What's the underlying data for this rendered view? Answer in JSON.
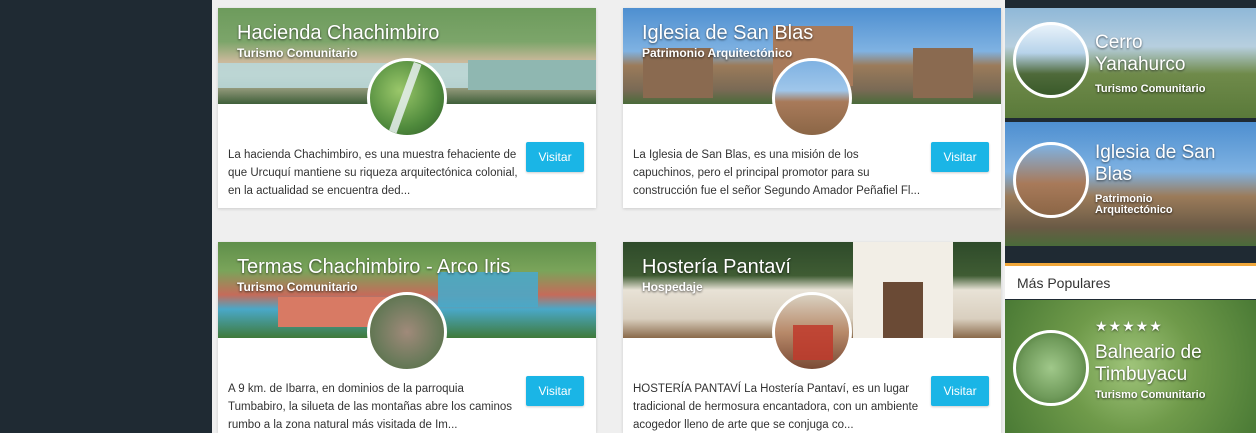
{
  "cards": [
    {
      "title": "Hacienda Chachimbiro",
      "subtitle": "Turismo Comunitario",
      "description": "La hacienda Chachimbiro, es una muestra fehaciente de que Urcuquí mantiene su riqueza arquitectónica colonial, en la actualidad se encuentra ded...",
      "button": "Visitar"
    },
    {
      "title": "Iglesia de San Blas",
      "subtitle": "Patrimonio Arquitectónico",
      "description": "La Iglesia de San Blas, es una misión de los capuchinos, pero el principal promotor para su construcción fue el señor Segundo Amador Peñafiel Fl...",
      "button": "Visitar"
    },
    {
      "title": "Termas Chachimbiro - Arco Iris",
      "subtitle": "Turismo Comunitario",
      "description": "A 9 km. de Ibarra, en dominios de la parroquia Tumbabiro, la silueta de las montañas abre los caminos rumbo a la zona natural más visitada de Im...",
      "button": "Visitar"
    },
    {
      "title": "Hostería Pantaví",
      "subtitle": "Hospedaje",
      "description": "HOSTERÍA PANTAVÍ La Hostería Pantaví, es un lugar tradicional de hermosura encantadora, con un ambiente acogedor lleno de arte que se conjuga co...",
      "button": "Visitar"
    }
  ],
  "sidebar": {
    "featured": [
      {
        "title": "Cerro Yanahurco",
        "subtitle": "Turismo Comunitario"
      },
      {
        "title": "Iglesia de San Blas",
        "subtitle": "Patrimonio Arquitectónico"
      }
    ],
    "popular_heading": "Más Populares",
    "popular": {
      "title": "Balneario de Timbuyacu",
      "subtitle": "Turismo Comunitario",
      "stars": "★★★★★"
    }
  },
  "colors": {
    "accent": "#1ab5e6",
    "dark": "#1f2a33",
    "popular_border": "#f0a73a"
  },
  "icons": {
    "rating": "star-icon"
  }
}
